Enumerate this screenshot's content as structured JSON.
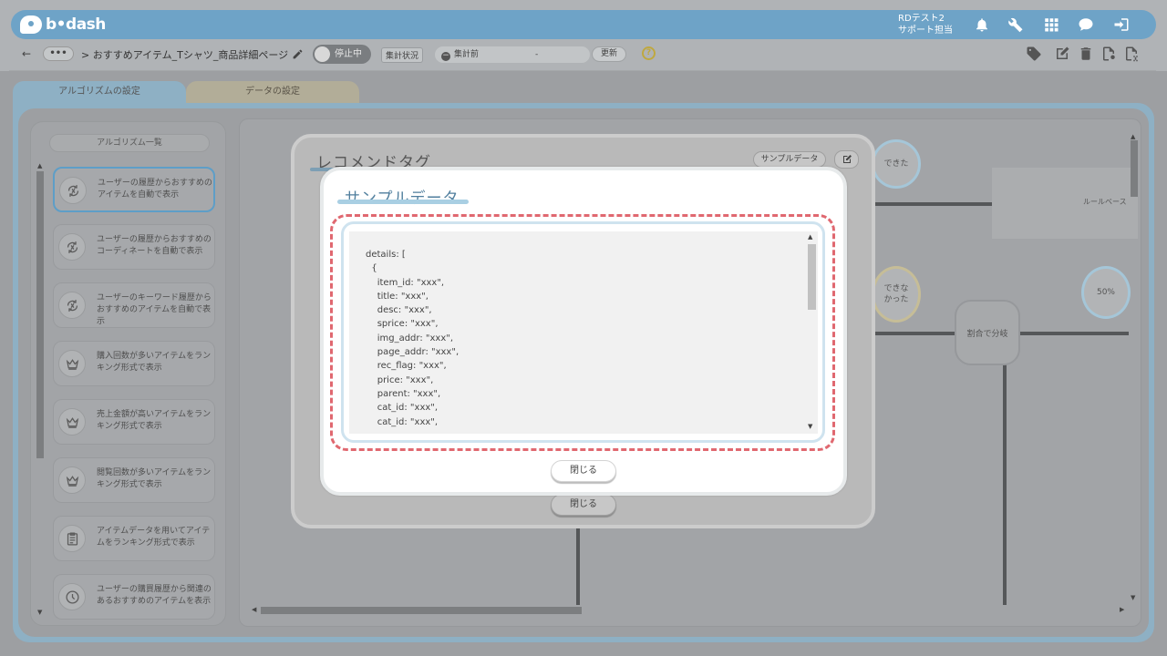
{
  "app": {
    "logo": "b•dash",
    "user_line1": "RDテスト2",
    "user_line2": "サポート担当"
  },
  "header_icons": [
    "bell-icon",
    "wrench-icon",
    "grid-icon",
    "chat-icon",
    "logout-icon"
  ],
  "toolbar": {
    "back": "←",
    "dots": "•••",
    "breadcrumb": "> おすすめアイテム_Tシャツ_商品詳細ページ",
    "toggle_label": "停止中",
    "status_label": "集計状況",
    "status_value": "集計前",
    "status_dash": "-",
    "refresh_label": "更新",
    "help": "?",
    "right_icons": [
      "tag-icon",
      "edit-icon",
      "trash-icon",
      "file-settings-icon",
      "file-delete-icon"
    ]
  },
  "tabs": [
    {
      "label": "アルゴリズムの設定"
    },
    {
      "label": "データの設定"
    }
  ],
  "sidebar": {
    "title": "アルゴリズム一覧",
    "items": [
      {
        "label": "ユーザーの履歴からおすすめのアイテムを自動で表示",
        "icon": "recycle-icon"
      },
      {
        "label": "ユーザーの履歴からおすすめのコーディネートを自動で表示",
        "icon": "recycle-icon"
      },
      {
        "label": "ユーザーのキーワード履歴からおすすめのアイテムを自動で表示",
        "icon": "recycle-icon"
      },
      {
        "label": "購入回数が多いアイテムをランキング形式で表示",
        "icon": "crown-icon"
      },
      {
        "label": "売上金額が高いアイテムをランキング形式で表示",
        "icon": "crown-icon"
      },
      {
        "label": "閲覧回数が多いアイテムをランキング形式で表示",
        "icon": "crown-icon"
      },
      {
        "label": "アイテムデータを用いてアイテムをランキング形式で表示",
        "icon": "clipboard-icon"
      },
      {
        "label": "ユーザーの購買履歴から関連のあるおすすめのアイテムを表示",
        "icon": "clock-icon"
      }
    ]
  },
  "canvas": {
    "node_success": "できた",
    "node_fail": "できな\nかった",
    "node_percent": "50%",
    "node_split": "割合で分岐",
    "rule_text": "ルールベース"
  },
  "outer_modal": {
    "title": "レコメンドタグ",
    "sample_button": "サンプルデータ",
    "close": "閉じる"
  },
  "inner_modal": {
    "title": "サンプルデータ",
    "code": "details: [\n  {\n    item_id: \"xxx\",\n    title: \"xxx\",\n    desc: \"xxx\",\n    sprice: \"xxx\",\n    img_addr: \"xxx\",\n    page_addr: \"xxx\",\n    rec_flag: \"xxx\",\n    price: \"xxx\",\n    parent: \"xxx\",\n    cat_id: \"xxx\",\n    cat_id: \"xxx\",",
    "close": "閉じる"
  },
  "colors": {
    "accent": "#6ea3c7",
    "highlight_dash": "#e06870",
    "title_blue": "#4f7e9d"
  }
}
